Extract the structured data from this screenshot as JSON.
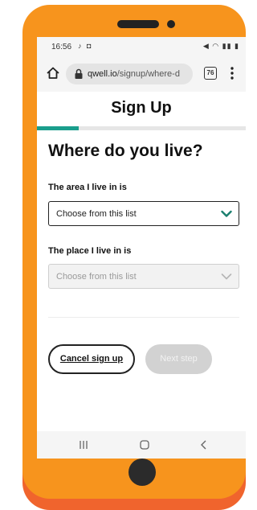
{
  "status_bar": {
    "time": "16:56",
    "left_icons": "♪ ◘",
    "right_icons": "◀ ◠ ▮▮ ▮"
  },
  "browser": {
    "url_domain": "qwell.io",
    "url_path": "/signup/where-d",
    "tab_count": "76"
  },
  "page": {
    "title": "Sign Up",
    "progress_percent": 20,
    "question": "Where do you live?"
  },
  "fields": {
    "area_label": "The area I live in is",
    "area_value": "Choose from this list",
    "place_label": "The place I live in is",
    "place_value": "Choose from this list"
  },
  "actions": {
    "cancel_label": "Cancel sign up",
    "next_label": "Next step"
  },
  "colors": {
    "phone_body": "#f7941d",
    "phone_shadow": "#f0642d",
    "progress": "#1a9e8c",
    "chevron_active": "#1a7f6e"
  }
}
